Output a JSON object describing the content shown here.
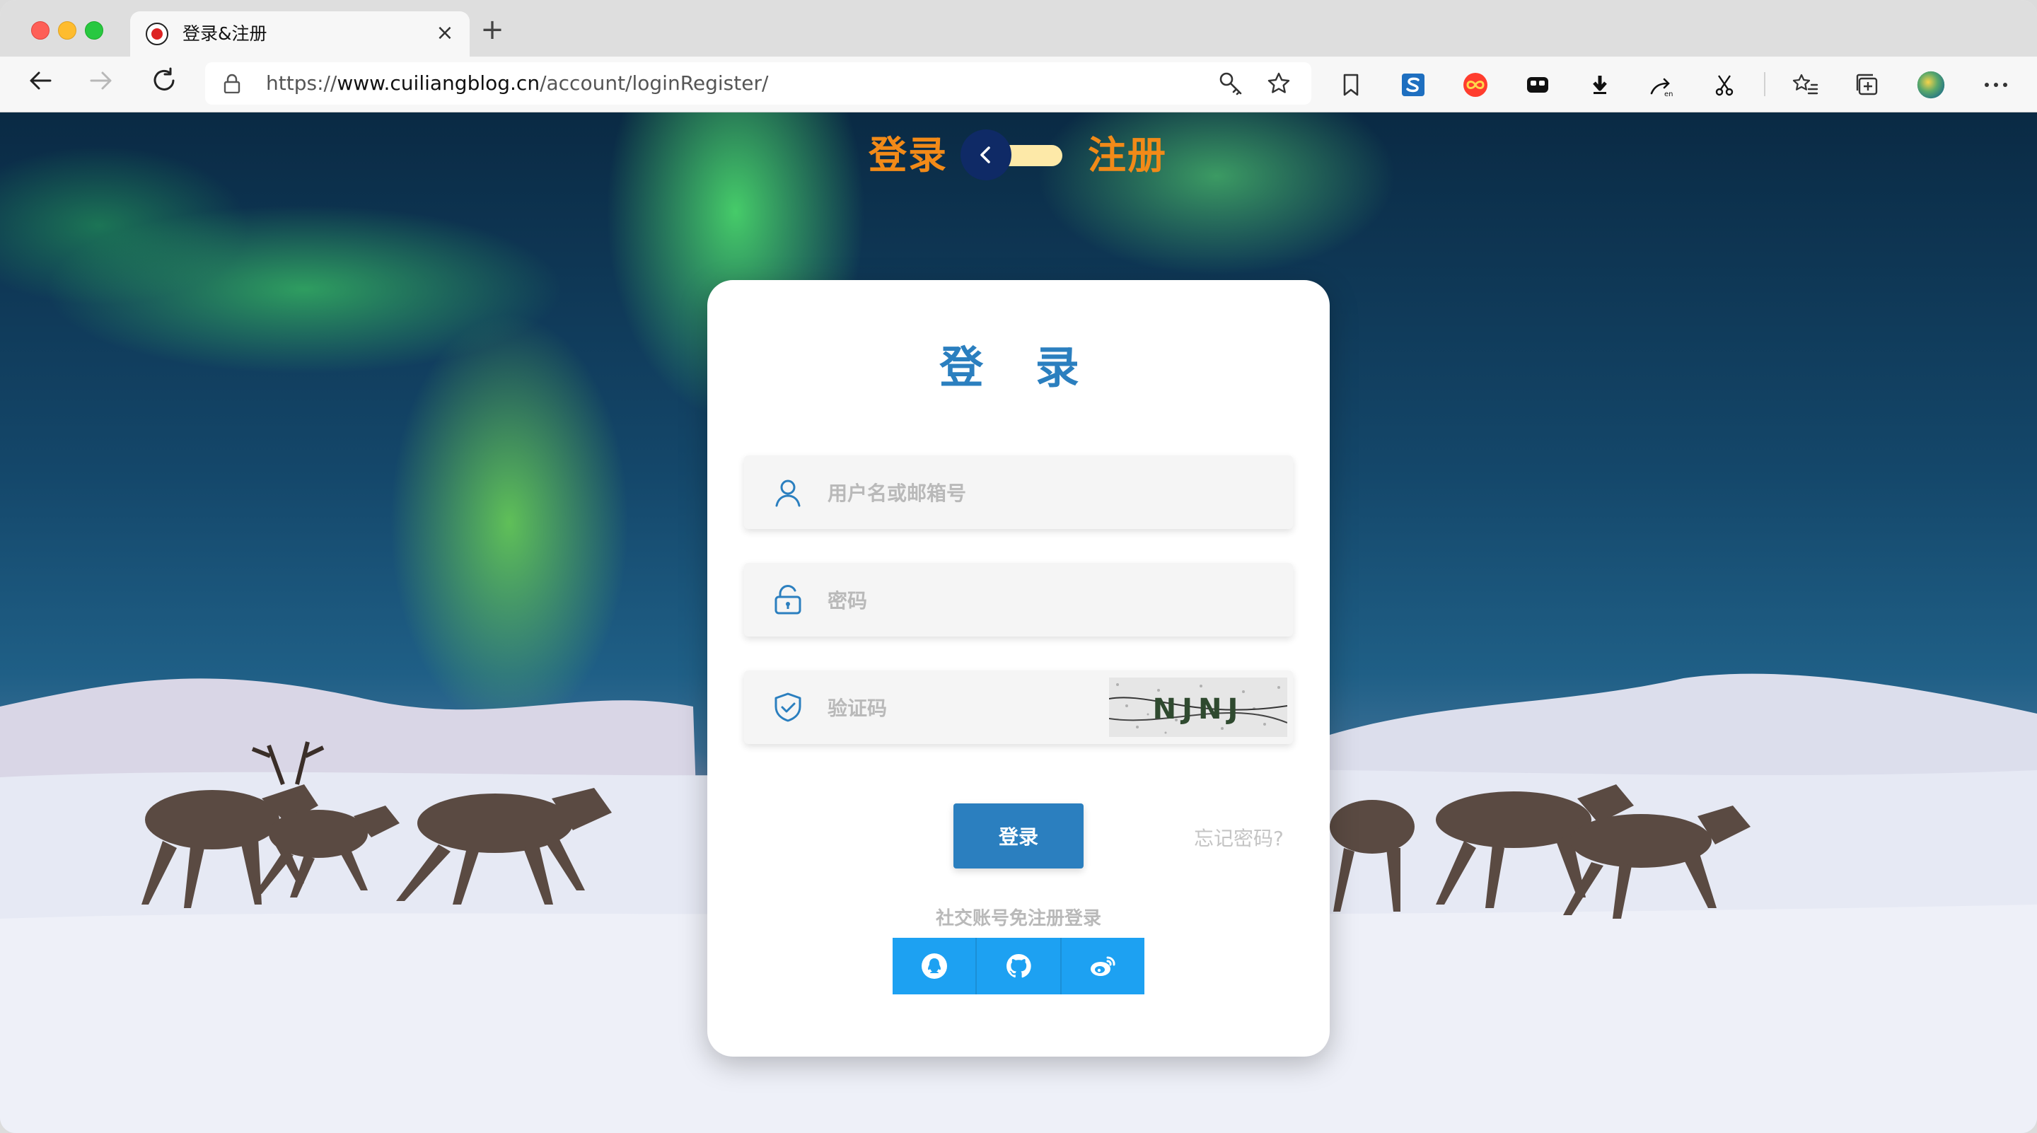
{
  "browser": {
    "tab_title": "登录&注册",
    "url_proto": "https://",
    "url_host": "www.cuiliangblog.cn",
    "url_path": "/account/loginRegister/"
  },
  "toolbar_icons": [
    "back-icon",
    "forward-icon",
    "reload-icon",
    "lock-icon",
    "key-icon",
    "star-icon",
    "bookmark-icon",
    "s-extension-icon",
    "infinity-extension-icon",
    "mask-extension-icon",
    "download-arrow-icon",
    "translate-icon",
    "scissors-icon",
    "favorites-icon",
    "collections-icon",
    "profile-avatar",
    "more-icon"
  ],
  "switcher": {
    "login_label": "登录",
    "register_label": "注册"
  },
  "login_card": {
    "title": "登 录",
    "username_placeholder": "用户名或邮箱号",
    "password_placeholder": "密码",
    "captcha_placeholder": "验证码",
    "captcha_text": "NJNJ",
    "submit_label": "登录",
    "forgot_label": "忘记密码?",
    "social_label": "社交账号免注册登录"
  },
  "colors": {
    "accent_blue": "#2b7fbf",
    "switch_orange": "#f28a18",
    "social_blue": "#1da1f2"
  }
}
